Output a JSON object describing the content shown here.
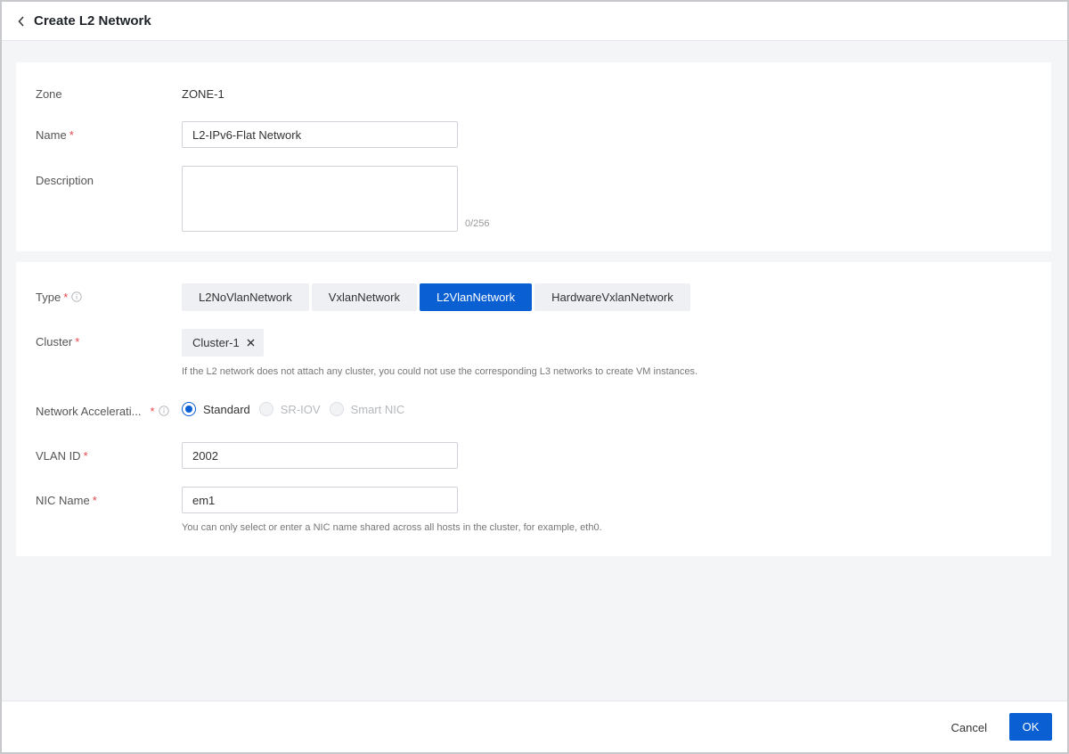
{
  "header": {
    "title": "Create L2 Network"
  },
  "basic": {
    "zone_label": "Zone",
    "zone_value": "ZONE-1",
    "name_label": "Name",
    "required_mark": "*",
    "name_value": "L2-IPv6-Flat Network",
    "description_label": "Description",
    "description_value": "",
    "description_counter": "0/256"
  },
  "network": {
    "type_label": "Type",
    "type_options": [
      "L2NoVlanNetwork",
      "VxlanNetwork",
      "L2VlanNetwork",
      "HardwareVxlanNetwork"
    ],
    "type_selected": "L2VlanNetwork",
    "cluster_label": "Cluster",
    "cluster_tag": "Cluster-1",
    "cluster_help": "If the L2 network does not attach any cluster, you could not use the corresponding L3 networks to create VM instances.",
    "acceleration_label": "Network Accelerati...",
    "acceleration_options": [
      {
        "label": "Standard",
        "checked": true,
        "disabled": false
      },
      {
        "label": "SR-IOV",
        "checked": false,
        "disabled": true
      },
      {
        "label": "Smart NIC",
        "checked": false,
        "disabled": true
      }
    ],
    "vlan_label": "VLAN ID",
    "vlan_value": "2002",
    "nic_label": "NIC Name",
    "nic_value": "em1",
    "nic_help": "You can only select or enter a NIC name shared across all hosts in the cluster, for example, eth0."
  },
  "footer": {
    "cancel_label": "Cancel",
    "ok_label": "OK"
  },
  "colors": {
    "primary": "#0a5fd2",
    "required": "#e5484d",
    "background": "#f4f5f7"
  },
  "icons": {
    "back": "chevron-left-icon",
    "info": "info-circle-icon",
    "close": "close-icon"
  }
}
